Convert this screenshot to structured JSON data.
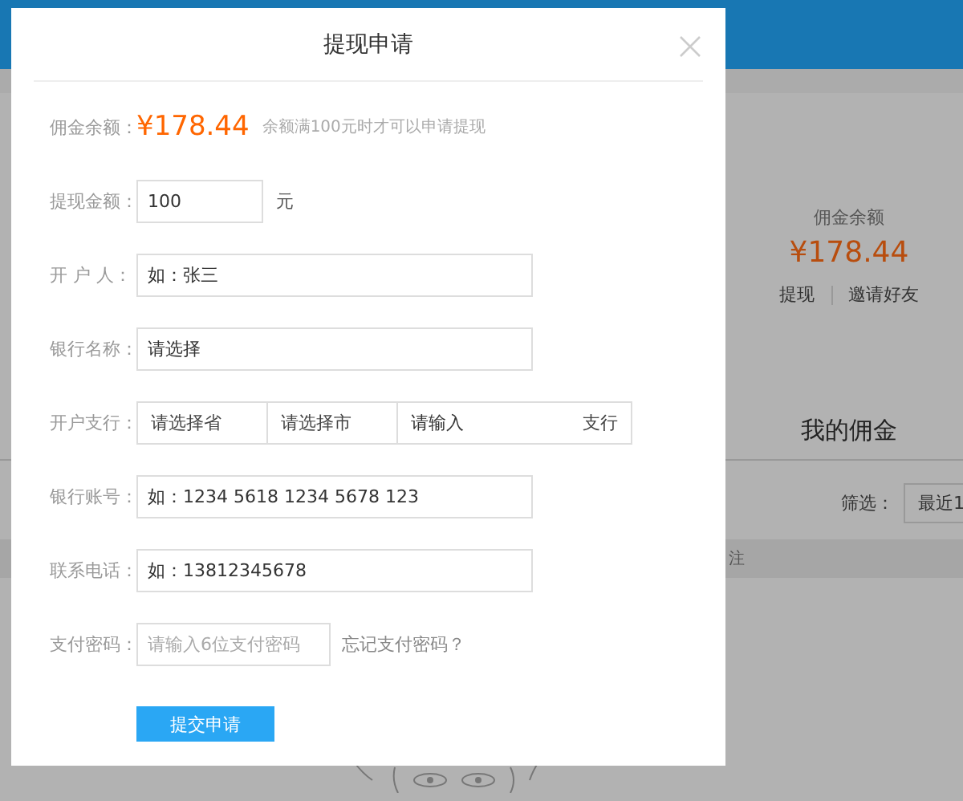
{
  "background": {
    "balance_panel": {
      "label": "佣金余额",
      "amount": "¥178.44",
      "actions": [
        "提现",
        "邀请好友"
      ]
    },
    "tab_label": "我的佣金",
    "filter": {
      "label": "筛选：",
      "value": "最近1"
    },
    "table_header_fragment": "注"
  },
  "dialog": {
    "title": "提现申请",
    "balance": {
      "label": "佣金余额：",
      "amount": "¥178.44",
      "hint": "余额满100元时才可以申请提现"
    },
    "fields": [
      {
        "kind": "amount",
        "label": "提现金额：",
        "value": "100",
        "unit": "元"
      },
      {
        "kind": "text",
        "label": "开 户 人：",
        "value": "如：张三"
      },
      {
        "kind": "text",
        "label": "银行名称：",
        "value": "请选择"
      },
      {
        "kind": "branch",
        "label": "开户支行：",
        "province": "请选择省",
        "city": "请选择市",
        "value": "请输入",
        "suffix": "支行"
      },
      {
        "kind": "text",
        "label": "银行账号：",
        "value": "如：1234 5618 1234 5678 123"
      },
      {
        "kind": "text",
        "label": "联系电话：",
        "value": "如：13812345678"
      },
      {
        "kind": "password",
        "label": "支付密码：",
        "placeholder": "请输入6位支付密码",
        "link": "忘记支付密码？"
      }
    ],
    "submit": "提交申请"
  }
}
